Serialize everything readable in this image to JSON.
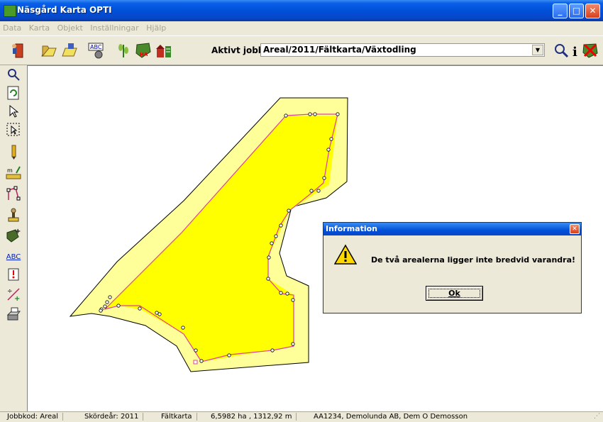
{
  "window": {
    "title": "Näsgård Karta OPTI"
  },
  "menu": [
    "Data",
    "Karta",
    "Objekt",
    "Inställningar",
    "Hjälp"
  ],
  "toolbar": {
    "aktivt_label": "Aktivt jobb",
    "job_value": "Areal/2011/Fältkarta/Växtodling",
    "icons": [
      "exit-icon",
      "open-map-icon",
      "save-map-icon",
      "text-abc-icon",
      "crop-icon",
      "field-ha-icon",
      "farm-buildings-icon",
      "zoom-icon",
      "info-icon",
      "close-map-icon"
    ]
  },
  "left_tools": [
    "zoom-icon",
    "refresh-icon",
    "pointer-icon",
    "select-area-icon",
    "pencil-icon",
    "measure-icon",
    "edit-nodes-icon",
    "stamp-icon",
    "add-field-icon",
    "text-abc-icon",
    "marker-icon",
    "split-icon",
    "print-icon"
  ],
  "left_labels": {
    "abc": "ABC",
    "measure": "m"
  },
  "colors": {
    "field_outer": "#ffff99",
    "field_inner": "#ffff00",
    "boundary": "#e0409a",
    "vertex": "#ffffff"
  },
  "dialog": {
    "title": "Information",
    "message": "De två arealerna ligger inte bredvid varandra!",
    "ok_label": "Ok"
  },
  "status": {
    "jobbkod": "Jobbkod: Areal",
    "skordear": "Skördeår: 2011",
    "layer": "Fältkarta",
    "area": "6,5982 ha , 1312,92 m",
    "owner": "AA1234, Demolunda AB, Dem O Demosson"
  }
}
